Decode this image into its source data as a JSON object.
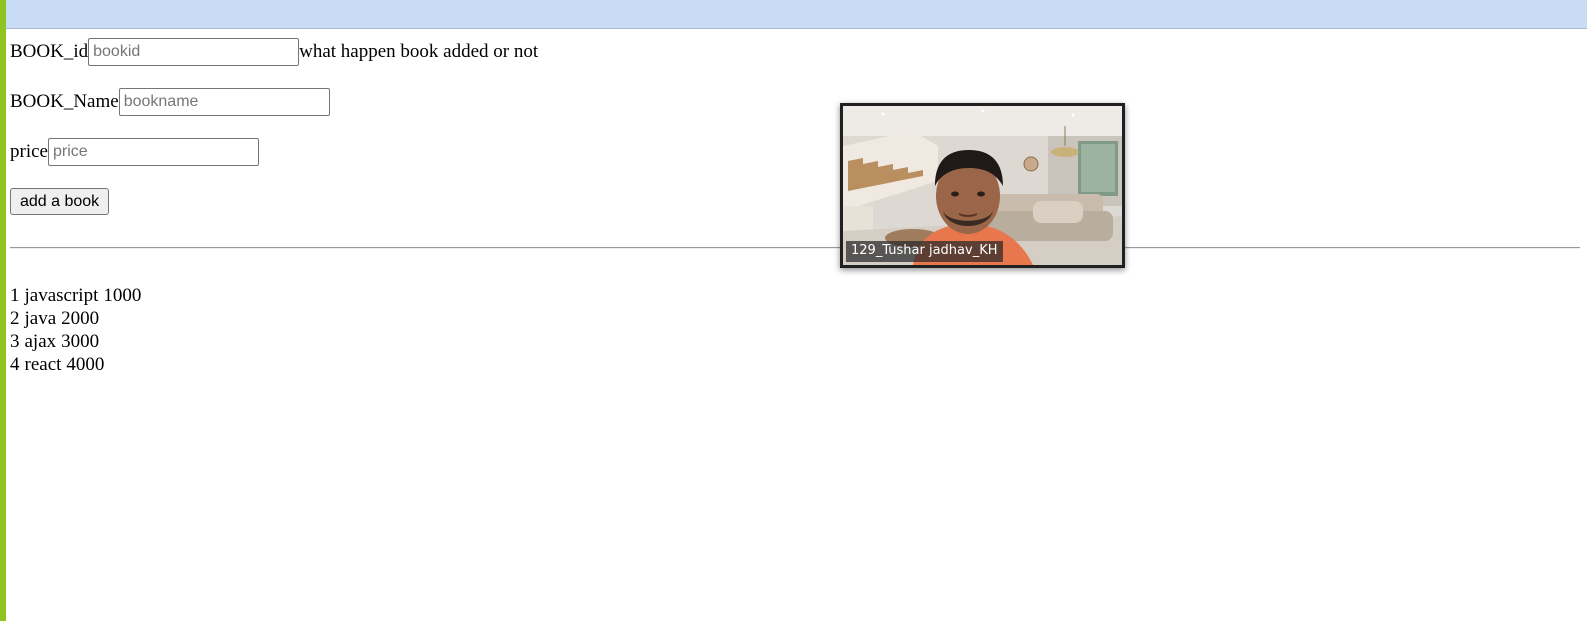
{
  "form": {
    "book_id_label": "BOOK_id",
    "book_id_placeholder": "bookid",
    "book_id_value": "",
    "status_text": "what happen book added or not",
    "book_name_label": "BOOK_Name",
    "book_name_placeholder": "bookname",
    "book_name_value": "",
    "price_label": "price",
    "price_placeholder": "price",
    "price_value": "",
    "add_button_label": "add a book"
  },
  "books": [
    {
      "id": "1",
      "name": "javascript",
      "price": "1000"
    },
    {
      "id": "2",
      "name": "java",
      "price": "2000"
    },
    {
      "id": "3",
      "name": "ajax",
      "price": "3000"
    },
    {
      "id": "4",
      "name": "react",
      "price": "4000"
    }
  ],
  "video_overlay": {
    "participant_name": "129_Tushar jadhav_KH"
  },
  "colors": {
    "top_bar": "#c9dcf5",
    "left_accent": "#8fc31f"
  }
}
